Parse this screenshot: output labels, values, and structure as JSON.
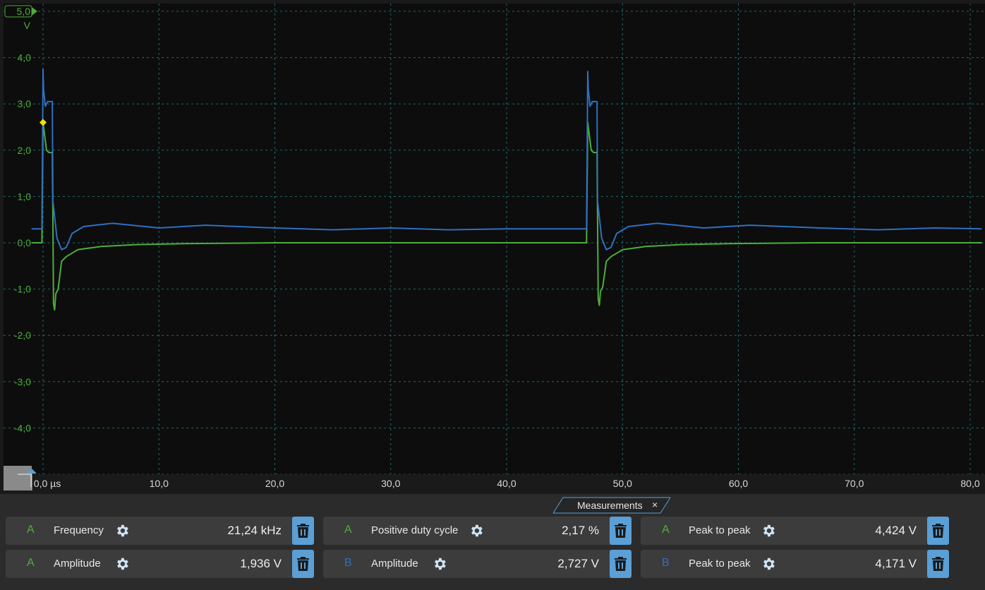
{
  "chart_data": {
    "type": "line",
    "x_unit": "µs",
    "y_unit": "V",
    "ylim": [
      -5.0,
      5.0
    ],
    "xlim": [
      -1.0,
      81.0
    ],
    "y_ticks": [
      "5,0",
      "4,0",
      "3,0",
      "2,0",
      "1,0",
      "0,0",
      "-1,0",
      "-2,0",
      "-3,0",
      "-4,0"
    ],
    "x_ticks": [
      "0,0 µs",
      "10,0",
      "20,0",
      "30,0",
      "40,0",
      "50,0",
      "60,0",
      "70,0",
      "80,0"
    ],
    "y_unit_label": "V",
    "grid": true,
    "trigger": {
      "x": 0.0,
      "y": 2.6
    },
    "series": [
      {
        "channel": "A",
        "color": "#4caf3a",
        "x": [
          -1.0,
          -0.1,
          0.0,
          0.1,
          0.3,
          0.5,
          0.8,
          0.85,
          0.9,
          1.0,
          1.1,
          1.3,
          1.6,
          2.0,
          3.0,
          5.0,
          8.0,
          12.0,
          20.0,
          30.0,
          40.0,
          46.9,
          47.0,
          47.1,
          47.3,
          47.5,
          47.8,
          47.85,
          47.9,
          48.0,
          48.1,
          48.3,
          48.6,
          49.0,
          50.0,
          52.0,
          55.0,
          59.0,
          67.0,
          75.0,
          81.0
        ],
        "y": [
          0.0,
          0.0,
          2.6,
          2.4,
          2.0,
          1.95,
          1.95,
          0.5,
          -1.3,
          -1.45,
          -1.1,
          -1.0,
          -0.4,
          -0.3,
          -0.15,
          -0.08,
          -0.04,
          -0.02,
          0.0,
          0.0,
          0.0,
          0.0,
          2.6,
          2.4,
          2.0,
          1.95,
          1.95,
          0.5,
          -1.2,
          -1.35,
          -1.05,
          -0.95,
          -0.4,
          -0.3,
          -0.15,
          -0.08,
          -0.04,
          -0.02,
          0.0,
          0.0,
          0.0
        ]
      },
      {
        "channel": "B",
        "color": "#2f6fc4",
        "x": [
          -1.0,
          -0.1,
          0.0,
          0.05,
          0.2,
          0.4,
          0.8,
          0.85,
          1.2,
          1.6,
          2.0,
          2.5,
          3.5,
          6.0,
          10.0,
          14.0,
          20.0,
          25.0,
          30.0,
          35.0,
          40.0,
          46.9,
          47.0,
          47.05,
          47.2,
          47.4,
          47.8,
          47.85,
          48.2,
          48.6,
          49.0,
          49.5,
          50.5,
          53.0,
          57.0,
          61.0,
          67.0,
          72.0,
          77.0,
          81.0
        ],
        "y": [
          0.3,
          0.3,
          3.75,
          3.3,
          2.95,
          3.05,
          3.05,
          0.9,
          0.1,
          -0.15,
          -0.1,
          0.2,
          0.35,
          0.42,
          0.32,
          0.38,
          0.32,
          0.28,
          0.32,
          0.28,
          0.3,
          0.3,
          3.7,
          3.3,
          2.95,
          3.05,
          3.05,
          0.9,
          0.1,
          -0.15,
          -0.1,
          0.2,
          0.35,
          0.42,
          0.32,
          0.38,
          0.32,
          0.28,
          0.32,
          0.3
        ]
      }
    ]
  },
  "measurements_tab": {
    "label": "Measurements",
    "close": "×"
  },
  "measurements": [
    {
      "channel": "A",
      "name": "Frequency",
      "value": "21,24 kHz"
    },
    {
      "channel": "A",
      "name": "Positive duty cycle",
      "value": "2,17 %"
    },
    {
      "channel": "A",
      "name": "Peak to peak",
      "value": "4,424 V"
    },
    {
      "channel": "A",
      "name": "Amplitude",
      "value": "1,936 V"
    },
    {
      "channel": "B",
      "name": "Amplitude",
      "value": "2,727 V"
    },
    {
      "channel": "B",
      "name": "Peak to peak",
      "value": "4,171 V"
    }
  ],
  "colors": {
    "channel_A": "#4caf3a",
    "channel_B": "#2f6fc4",
    "plot_bg": "#0d0d0d",
    "grid": "#1f6b6b",
    "accent": "#5a9fd6"
  }
}
